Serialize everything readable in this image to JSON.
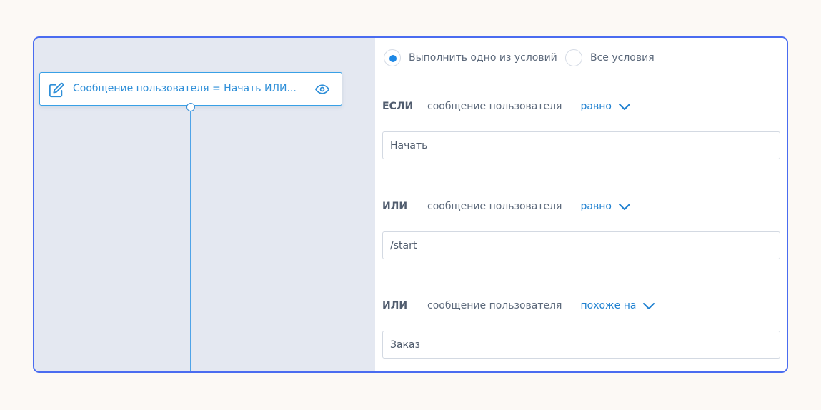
{
  "node": {
    "title": "Сообщение пользователя = Начать ИЛИ...",
    "edit_icon": "edit-icon",
    "eye_icon": "eye-icon"
  },
  "mode": {
    "options": [
      "Выполнить одно из условий",
      "Все условия"
    ],
    "selected": "Выполнить одно из условий"
  },
  "conditions": [
    {
      "keyword": "ЕСЛИ",
      "field": "сообщение пользователя",
      "operator": "равно",
      "value": "Начать"
    },
    {
      "keyword": "ИЛИ",
      "field": "сообщение пользователя",
      "operator": "равно",
      "value": "/start"
    },
    {
      "keyword": "ИЛИ",
      "field": "сообщение пользователя",
      "operator": "похоже на",
      "value": "Заказ"
    }
  ],
  "colors": {
    "accent": "#1e88e5",
    "frame_border": "#4a6cf0",
    "canvas_bg": "#e4e8f1",
    "page_bg": "#fcf9f5"
  }
}
